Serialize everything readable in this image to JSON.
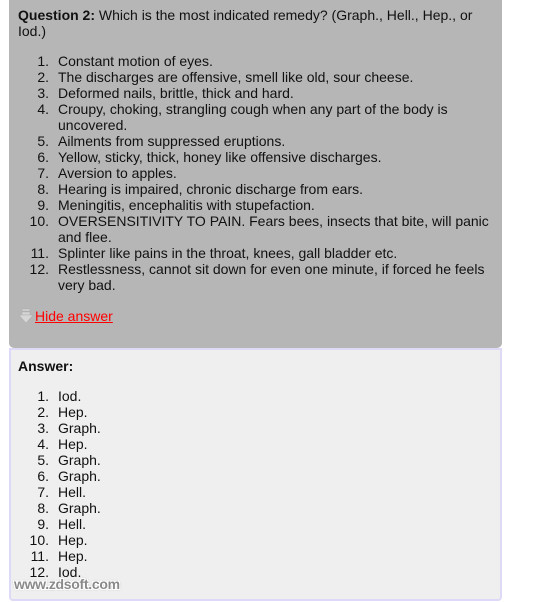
{
  "question": {
    "label": "Question 2:",
    "text": " Which is the most indicated remedy? (Graph., Hell., Hep., or Iod.)",
    "items": [
      {
        "num": "1.",
        "text": "Constant motion of eyes."
      },
      {
        "num": "2.",
        "text": "The discharges are offensive, smell like old, sour cheese."
      },
      {
        "num": "3.",
        "text": "Deformed nails, brittle, thick and hard."
      },
      {
        "num": "4.",
        "text": "Croupy, choking, strangling cough when any part of the body is uncovered."
      },
      {
        "num": "5.",
        "text": "Ailments from suppressed eruptions."
      },
      {
        "num": "6.",
        "text": "Yellow, sticky, thick, honey like offensive discharges."
      },
      {
        "num": "7.",
        "text": "Aversion to apples."
      },
      {
        "num": "8.",
        "text": "Hearing is impaired, chronic discharge from ears."
      },
      {
        "num": "9.",
        "text": "Meningitis, encephalitis with stupefaction."
      },
      {
        "num": "10.",
        "text": "OVERSENSITIVITY TO PAIN. Fears bees, insects that bite, will panic and flee."
      },
      {
        "num": "11.",
        "text": "Splinter like pains in the throat, knees, gall bladder etc."
      },
      {
        "num": "12.",
        "text": "Restlessness, cannot sit down for even one minute, if forced he feels very bad."
      }
    ]
  },
  "toggle": {
    "icon": "arrow-down-icon",
    "label": "Hide answer"
  },
  "answer": {
    "title": "Answer:",
    "items": [
      {
        "num": "1.",
        "text": "Iod."
      },
      {
        "num": "2.",
        "text": "Hep."
      },
      {
        "num": "3.",
        "text": "Graph."
      },
      {
        "num": "4.",
        "text": "Hep."
      },
      {
        "num": "5.",
        "text": "Graph."
      },
      {
        "num": "6.",
        "text": "Graph."
      },
      {
        "num": "7.",
        "text": "Hell."
      },
      {
        "num": "8.",
        "text": "Graph."
      },
      {
        "num": "9.",
        "text": "Hell."
      },
      {
        "num": "10.",
        "text": "Hep."
      },
      {
        "num": "11.",
        "text": "Hep."
      },
      {
        "num": "12.",
        "text": "Iod."
      }
    ]
  },
  "watermark": "www.zdsoft.com",
  "colors": {
    "question_bg": "#b6b6b6",
    "answer_bg": "#efefef",
    "answer_border": "#dcdaf6",
    "link": "#ff0000"
  }
}
